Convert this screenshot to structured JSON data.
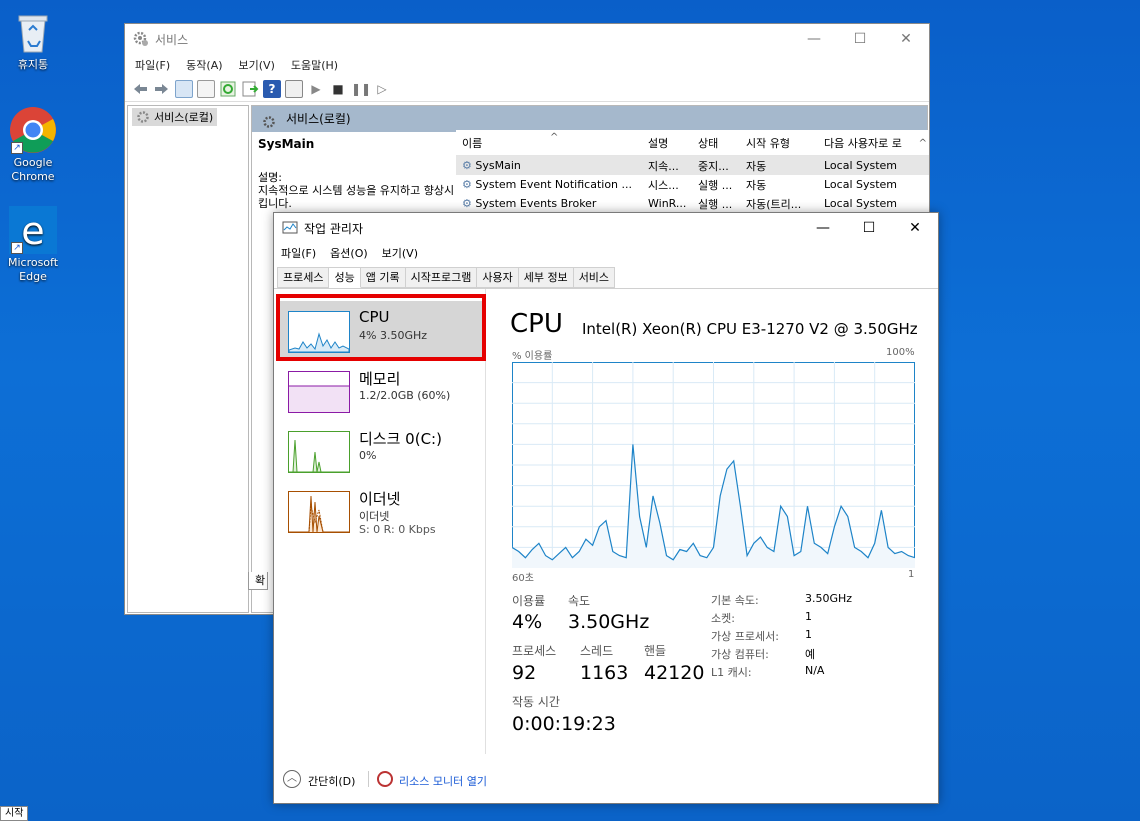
{
  "desktop": {
    "icons": [
      {
        "label": "휴지통",
        "icon": "recycle-bin-icon"
      },
      {
        "label": "Google Chrome",
        "icon": "chrome-icon"
      },
      {
        "label": "Microsoft Edge",
        "icon": "edge-icon"
      }
    ],
    "start_label": "시작"
  },
  "services": {
    "title": "서비스",
    "menu": [
      "파일(F)",
      "동작(A)",
      "보기(V)",
      "도움말(H)"
    ],
    "tree_item": "서비스(로컬)",
    "header": "서비스(로컬)",
    "selected_service": "SysMain",
    "desc_label": "설명:",
    "desc_text": "지속적으로 시스템 성능을 유지하고 향상시킵니다.",
    "tab_stub": "확",
    "columns": [
      "이름",
      "설명",
      "상태",
      "시작 유형",
      "다음 사용자로 로"
    ],
    "rows": [
      {
        "name": "SysMain",
        "desc": "지속...",
        "status": "중지...",
        "startup": "자동",
        "logon": "Local System"
      },
      {
        "name": "System Event Notification ...",
        "desc": "시스...",
        "status": "실행 ...",
        "startup": "자동",
        "logon": "Local System"
      },
      {
        "name": "System Events Broker",
        "desc": "WinR...",
        "status": "실행 ...",
        "startup": "자동(트리...",
        "logon": "Local System"
      }
    ]
  },
  "taskmgr": {
    "title": "작업 관리자",
    "menu": [
      "파일(F)",
      "옵션(O)",
      "보기(V)"
    ],
    "tabs": [
      "프로세스",
      "성능",
      "앱 기록",
      "시작프로그램",
      "사용자",
      "세부 정보",
      "서비스"
    ],
    "active_tab": "성능",
    "resources": [
      {
        "name": "CPU",
        "sub": "4% 3.50GHz",
        "color": "#1e84c8"
      },
      {
        "name": "메모리",
        "sub": "1.2/2.0GB (60%)",
        "color": "#8b1aa6"
      },
      {
        "name": "디스크 0(C:)",
        "sub": "0%",
        "color": "#4aa02c"
      },
      {
        "name": "이더넷",
        "sub": "이더넷",
        "sub2": "S: 0 R: 0 Kbps",
        "color": "#a74f01"
      }
    ],
    "cpu": {
      "heading": "CPU",
      "model": "Intel(R) Xeon(R) CPU E3-1270 V2 @ 3.50GHz",
      "util_label": "% 이용률",
      "max_label": "100%",
      "time_left": "60초",
      "time_right": "1",
      "stats": {
        "util_label": "이용률",
        "util": "4%",
        "speed_label": "속도",
        "speed": "3.50GHz",
        "proc_label": "프로세스",
        "proc": "92",
        "thread_label": "스레드",
        "thread": "1163",
        "handle_label": "핸들",
        "handle": "42120",
        "uptime_label": "작동 시간",
        "uptime": "0:00:19:23"
      },
      "info": [
        {
          "label": "기본 속도:",
          "value": "3.50GHz"
        },
        {
          "label": "소켓:",
          "value": "1"
        },
        {
          "label": "가상 프로세서:",
          "value": "1"
        },
        {
          "label": "가상 컴퓨터:",
          "value": "예"
        },
        {
          "label": "L1 캐시:",
          "value": "N/A"
        }
      ]
    },
    "footer": {
      "simple": "간단히(D)",
      "monitor": "리소스 모니터 열기"
    }
  },
  "chart_data": {
    "type": "area",
    "title": "",
    "ylabel": "% 이용률",
    "ylim": [
      0,
      100
    ],
    "xlim": [
      60,
      0
    ],
    "x": [
      60,
      59,
      58,
      57,
      56,
      55,
      54,
      53,
      52,
      51,
      50,
      49,
      48,
      47,
      46,
      45,
      44,
      43,
      42,
      41,
      40,
      39,
      38,
      37,
      36,
      35,
      34,
      33,
      32,
      31,
      30,
      29,
      28,
      27,
      26,
      25,
      24,
      23,
      22,
      21,
      20,
      19,
      18,
      17,
      16,
      15,
      14,
      13,
      12,
      11,
      10,
      9,
      8,
      7,
      6,
      5,
      4,
      3,
      2,
      1,
      0
    ],
    "series": [
      {
        "values": [
          10,
          8,
          5,
          9,
          12,
          6,
          4,
          7,
          10,
          5,
          8,
          14,
          11,
          20,
          23,
          8,
          6,
          5,
          60,
          25,
          10,
          35,
          22,
          6,
          4,
          9,
          8,
          12,
          6,
          5,
          10,
          35,
          48,
          52,
          30,
          6,
          12,
          15,
          10,
          8,
          30,
          25,
          6,
          8,
          30,
          12,
          10,
          7,
          20,
          30,
          25,
          10,
          8,
          5,
          12,
          28,
          10,
          7,
          8,
          6,
          5
        ]
      }
    ],
    "grid": true
  }
}
